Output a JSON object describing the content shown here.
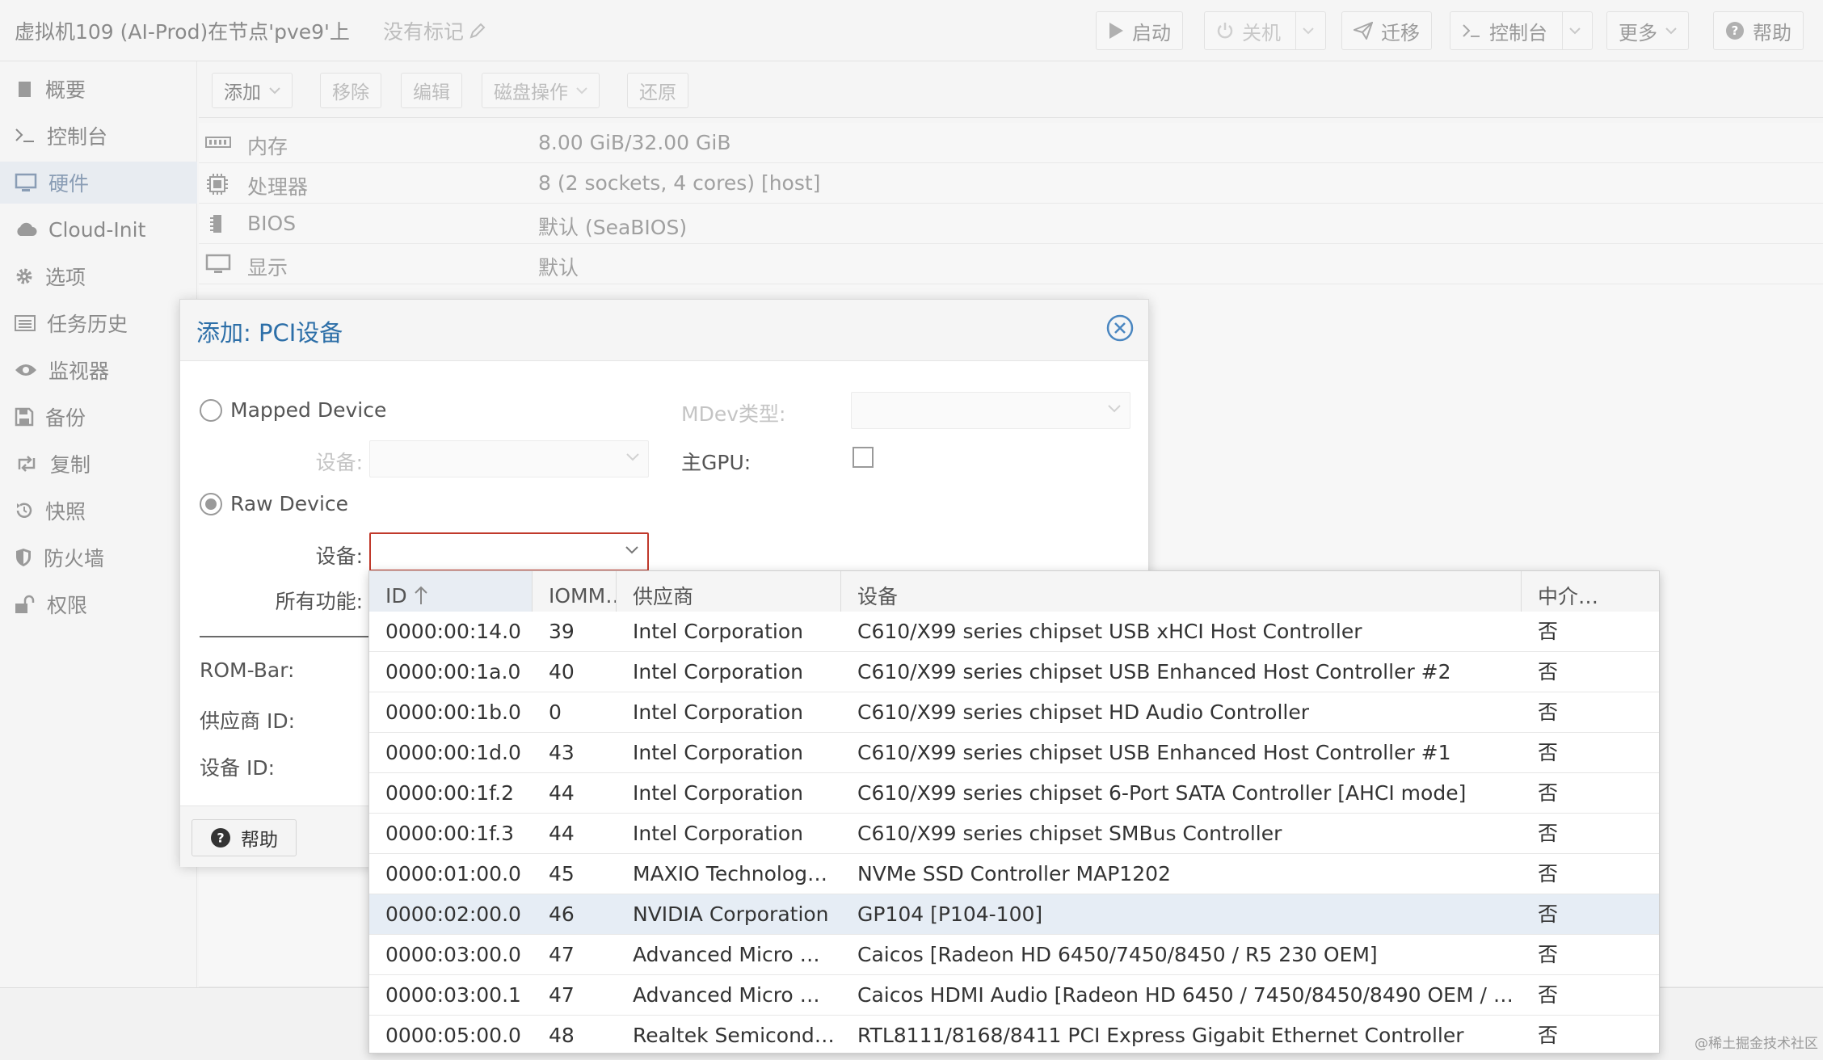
{
  "header": {
    "title": "虚拟机109 (AI-Prod)在节点'pve9'上",
    "tags_placeholder": "没有标记",
    "buttons": {
      "start": "启动",
      "shutdown": "关机",
      "migrate": "迁移",
      "console": "控制台",
      "more": "更多",
      "help": "帮助"
    }
  },
  "sidebar": {
    "items": [
      {
        "label": "概要",
        "icon": "book-icon"
      },
      {
        "label": "控制台",
        "icon": "terminal-icon"
      },
      {
        "label": "硬件",
        "icon": "monitor-icon",
        "active": true
      },
      {
        "label": "Cloud-Init",
        "icon": "cloud-icon"
      },
      {
        "label": "选项",
        "icon": "gear-icon"
      },
      {
        "label": "任务历史",
        "icon": "list-icon"
      },
      {
        "label": "监视器",
        "icon": "eye-icon"
      },
      {
        "label": "备份",
        "icon": "floppy-icon"
      },
      {
        "label": "复制",
        "icon": "retweet-icon"
      },
      {
        "label": "快照",
        "icon": "history-icon"
      },
      {
        "label": "防火墙",
        "icon": "shield-icon"
      },
      {
        "label": "权限",
        "icon": "unlock-icon"
      }
    ]
  },
  "hardware": {
    "toolbar": {
      "add": "添加",
      "remove": "移除",
      "edit": "编辑",
      "disk_action": "磁盘操作",
      "revert": "还原"
    },
    "rows": [
      {
        "name": "内存",
        "value": "8.00 GiB/32.00 GiB",
        "icon": "memory-icon"
      },
      {
        "name": "处理器",
        "value": "8 (2 sockets, 4 cores) [host]",
        "icon": "cpu-icon"
      },
      {
        "name": "BIOS",
        "value": "默认 (SeaBIOS)",
        "icon": "chip-icon"
      },
      {
        "name": "显示",
        "value": "默认",
        "icon": "monitor-icon"
      }
    ]
  },
  "dialog": {
    "title": "添加: PCI设备",
    "mapped_device_label": "Mapped Device",
    "mapped_device_field_label": "设备:",
    "mdev_type_label": "MDev类型:",
    "primary_gpu_label": "主GPU:",
    "raw_device_label": "Raw Device",
    "raw_device_field_label": "设备:",
    "all_functions_label": "所有功能:",
    "rombar_label": "ROM-Bar:",
    "vendor_id_label": "供应商 ID:",
    "device_id_label": "设备 ID:",
    "help_button": "帮助",
    "selected_mode": "raw"
  },
  "device_grid": {
    "columns": [
      "ID",
      "IOMM…",
      "供应商",
      "设备",
      "中介…"
    ],
    "sorted_column": "ID",
    "sort_direction": "ascending",
    "rows": [
      {
        "id": "0000:00:14.0",
        "iommu": "39",
        "vendor": "Intel Corporation",
        "device": "C610/X99 series chipset USB xHCI Host Controller",
        "mediated": "否"
      },
      {
        "id": "0000:00:1a.0",
        "iommu": "40",
        "vendor": "Intel Corporation",
        "device": "C610/X99 series chipset USB Enhanced Host Controller #2",
        "mediated": "否"
      },
      {
        "id": "0000:00:1b.0",
        "iommu": "0",
        "vendor": "Intel Corporation",
        "device": "C610/X99 series chipset HD Audio Controller",
        "mediated": "否"
      },
      {
        "id": "0000:00:1d.0",
        "iommu": "43",
        "vendor": "Intel Corporation",
        "device": "C610/X99 series chipset USB Enhanced Host Controller #1",
        "mediated": "否"
      },
      {
        "id": "0000:00:1f.2",
        "iommu": "44",
        "vendor": "Intel Corporation",
        "device": "C610/X99 series chipset 6-Port SATA Controller [AHCI mode]",
        "mediated": "否"
      },
      {
        "id": "0000:00:1f.3",
        "iommu": "44",
        "vendor": "Intel Corporation",
        "device": "C610/X99 series chipset SMBus Controller",
        "mediated": "否"
      },
      {
        "id": "0000:01:00.0",
        "iommu": "45",
        "vendor": "MAXIO Technolog…",
        "device": "NVMe SSD Controller MAP1202",
        "mediated": "否"
      },
      {
        "id": "0000:02:00.0",
        "iommu": "46",
        "vendor": "NVIDIA Corporation",
        "device": "GP104 [P104-100]",
        "mediated": "否",
        "selected": true
      },
      {
        "id": "0000:03:00.0",
        "iommu": "47",
        "vendor": "Advanced Micro …",
        "device": "Caicos [Radeon HD 6450/7450/8450 / R5 230 OEM]",
        "mediated": "否"
      },
      {
        "id": "0000:03:00.1",
        "iommu": "47",
        "vendor": "Advanced Micro …",
        "device": "Caicos HDMI Audio [Radeon HD 6450 / 7450/8450/8490 OEM / R…",
        "mediated": "否"
      },
      {
        "id": "0000:05:00.0",
        "iommu": "48",
        "vendor": "Realtek Semicond…",
        "device": "RTL8111/8168/8411 PCI Express Gigabit Ethernet Controller",
        "mediated": "否"
      }
    ]
  },
  "watermark": "@稀土掘金技术社区",
  "colors": {
    "accent": "#2d6fa8",
    "selected_row": "#e6edf5",
    "error_border": "#c0392b"
  }
}
